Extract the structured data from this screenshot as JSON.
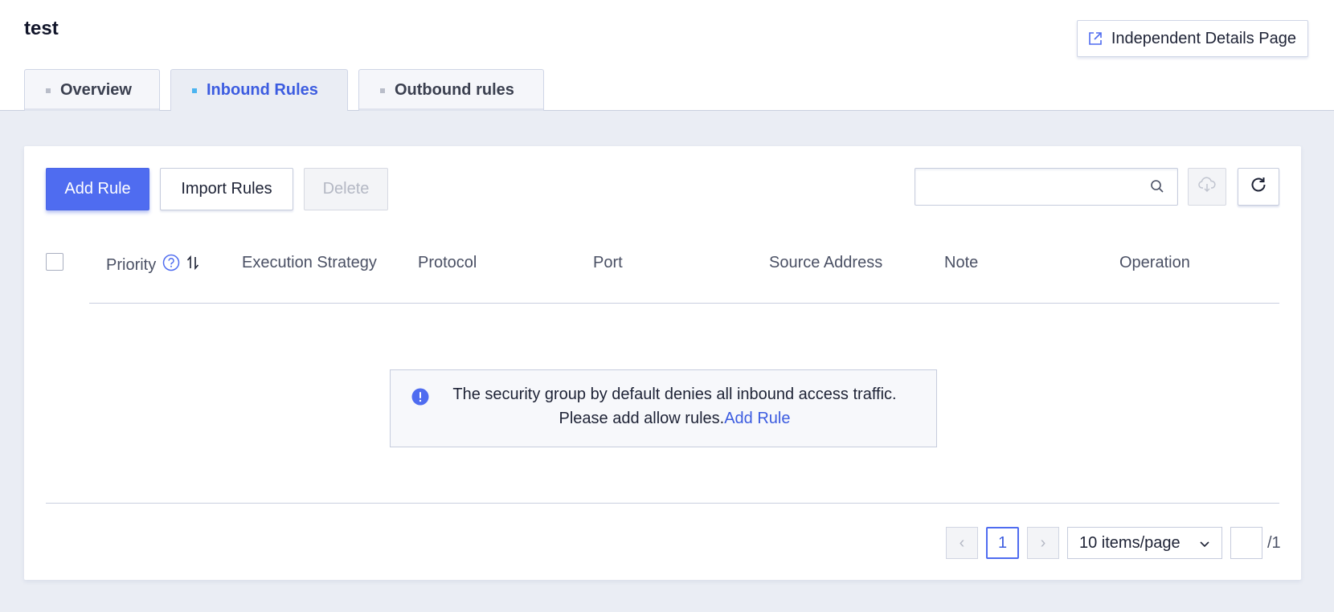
{
  "header": {
    "title": "test",
    "details_button_label": "Independent Details Page",
    "details_icon": "external-link-icon"
  },
  "tabs": [
    {
      "label": "Overview",
      "active": false
    },
    {
      "label": "Inbound Rules",
      "active": true
    },
    {
      "label": "Outbound rules",
      "active": false
    }
  ],
  "toolbar": {
    "add_rule_label": "Add Rule",
    "import_rules_label": "Import Rules",
    "delete_label": "Delete",
    "search_placeholder": "",
    "search_icon": "search-icon",
    "download_icon": "cloud-download-icon",
    "refresh_icon": "refresh-icon"
  },
  "table": {
    "columns": [
      "Priority",
      "Execution Strategy",
      "Protocol",
      "Port",
      "Source Address",
      "Note",
      "Operation"
    ],
    "rows": []
  },
  "empty_notice": {
    "text": "The security group by default denies all inbound access traffic. Please add allow rules.",
    "link": "Add Rule",
    "icon": "info-icon"
  },
  "pagination": {
    "prev": "‹",
    "next": "›",
    "current_page": "1",
    "page_size_label": "10 items/page",
    "page_input": "",
    "total_pages": "/1"
  },
  "colors": {
    "primary": "#4f6cf0",
    "link": "#3c5ce0",
    "active_tab_dot": "#4cb4f0",
    "background": "#eaedf4"
  }
}
